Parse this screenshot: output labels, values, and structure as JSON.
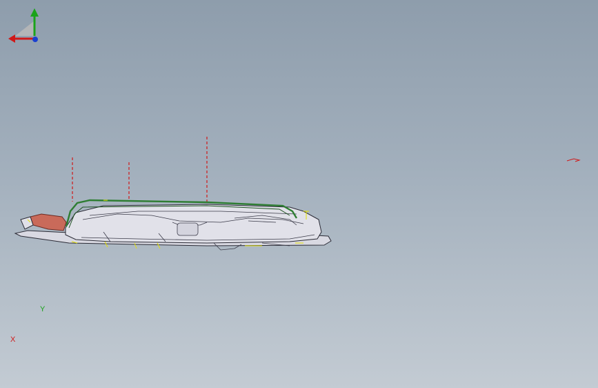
{
  "viewport": {
    "background_top": "#8e9dac",
    "background_bottom": "#c3cbd3"
  },
  "model": {
    "body_color": "#dcdce4",
    "outline_color": "#2a2a35",
    "seal_color": "#2e7d32",
    "handle_color": "#c96a5a",
    "annotation_color": "#e6e200",
    "reference_color": "#d01818"
  },
  "triad": {
    "x_label": "X",
    "y_label": "Y",
    "x_color": "#d01818",
    "y_color": "#1aa31a",
    "z_color": "#1a3fd0",
    "icon": "coordinate-triad-icon"
  }
}
